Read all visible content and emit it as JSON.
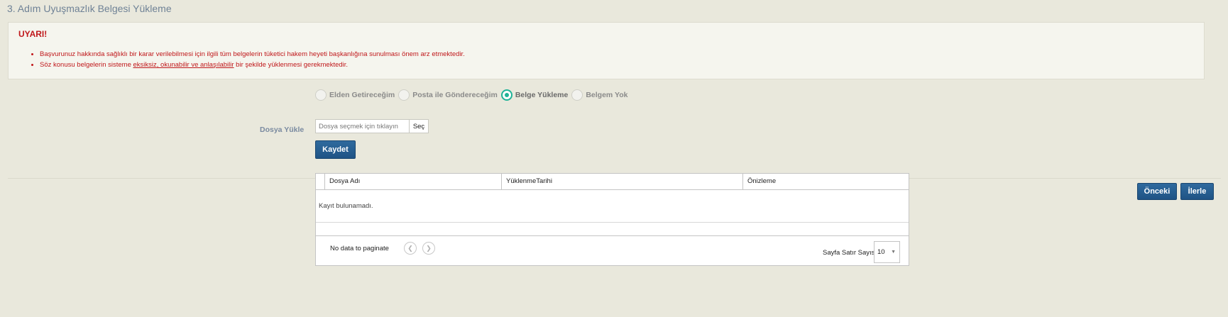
{
  "step": {
    "title": "3. Adım Uyuşmazlık Belgesi Yükleme"
  },
  "warning": {
    "title": "UYARI!",
    "item1": "Başvurunuz hakkında sağlıklı bir karar verilebilmesi için ilgili tüm belgelerin tüketici hakem heyeti başkanlığına sunulması önem arz etmektedir.",
    "item2_pre": "Söz konusu belgelerin sisteme ",
    "item2_underline": "eksiksiz, okunabilir ve anlaşılabilir",
    "item2_post": " bir şekilde yüklenmesi gerekmektedir.",
    "color": "#c0181b"
  },
  "delivery": {
    "options": [
      "Elden Getireceğim",
      "Posta ile Göndereceğim",
      "Belge Yükleme",
      "Belgem Yok"
    ],
    "selected": "Belge Yükleme",
    "accent_color": "#1fb397"
  },
  "upload": {
    "label": "Dosya Yükle",
    "placeholder": "Dosya seçmek için tıklayın",
    "choose_button": "Seç",
    "save_button": "Kaydet"
  },
  "grid": {
    "columns": [
      "Dosya Adı",
      "YüklenmeTarihi",
      "Önizleme"
    ],
    "empty_message": "Kayıt bulunamadı.",
    "paginator_text": "No data to paginate",
    "rows_label": "Sayfa Satır Sayısı",
    "rows_value": "10"
  },
  "nav": {
    "prev_button": "Önceki",
    "next_button": "İlerle"
  },
  "icons": {
    "prev_page": "chevron-left-icon",
    "next_page": "chevron-right-icon",
    "select_arrow": "caret-down-icon"
  },
  "colors": {
    "background": "#e9e8dc",
    "primary_button": "#1f5385"
  }
}
